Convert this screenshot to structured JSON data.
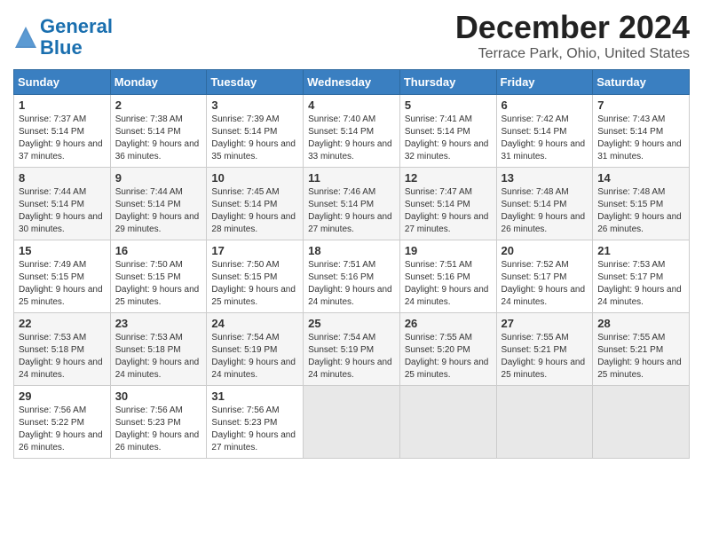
{
  "header": {
    "logo_line1": "General",
    "logo_line2": "Blue",
    "month": "December 2024",
    "location": "Terrace Park, Ohio, United States"
  },
  "weekdays": [
    "Sunday",
    "Monday",
    "Tuesday",
    "Wednesday",
    "Thursday",
    "Friday",
    "Saturday"
  ],
  "weeks": [
    [
      {
        "day": "1",
        "sunrise": "7:37 AM",
        "sunset": "5:14 PM",
        "daylight": "9 hours and 37 minutes."
      },
      {
        "day": "2",
        "sunrise": "7:38 AM",
        "sunset": "5:14 PM",
        "daylight": "9 hours and 36 minutes."
      },
      {
        "day": "3",
        "sunrise": "7:39 AM",
        "sunset": "5:14 PM",
        "daylight": "9 hours and 35 minutes."
      },
      {
        "day": "4",
        "sunrise": "7:40 AM",
        "sunset": "5:14 PM",
        "daylight": "9 hours and 33 minutes."
      },
      {
        "day": "5",
        "sunrise": "7:41 AM",
        "sunset": "5:14 PM",
        "daylight": "9 hours and 32 minutes."
      },
      {
        "day": "6",
        "sunrise": "7:42 AM",
        "sunset": "5:14 PM",
        "daylight": "9 hours and 31 minutes."
      },
      {
        "day": "7",
        "sunrise": "7:43 AM",
        "sunset": "5:14 PM",
        "daylight": "9 hours and 31 minutes."
      }
    ],
    [
      {
        "day": "8",
        "sunrise": "7:44 AM",
        "sunset": "5:14 PM",
        "daylight": "9 hours and 30 minutes."
      },
      {
        "day": "9",
        "sunrise": "7:44 AM",
        "sunset": "5:14 PM",
        "daylight": "9 hours and 29 minutes."
      },
      {
        "day": "10",
        "sunrise": "7:45 AM",
        "sunset": "5:14 PM",
        "daylight": "9 hours and 28 minutes."
      },
      {
        "day": "11",
        "sunrise": "7:46 AM",
        "sunset": "5:14 PM",
        "daylight": "9 hours and 27 minutes."
      },
      {
        "day": "12",
        "sunrise": "7:47 AM",
        "sunset": "5:14 PM",
        "daylight": "9 hours and 27 minutes."
      },
      {
        "day": "13",
        "sunrise": "7:48 AM",
        "sunset": "5:14 PM",
        "daylight": "9 hours and 26 minutes."
      },
      {
        "day": "14",
        "sunrise": "7:48 AM",
        "sunset": "5:15 PM",
        "daylight": "9 hours and 26 minutes."
      }
    ],
    [
      {
        "day": "15",
        "sunrise": "7:49 AM",
        "sunset": "5:15 PM",
        "daylight": "9 hours and 25 minutes."
      },
      {
        "day": "16",
        "sunrise": "7:50 AM",
        "sunset": "5:15 PM",
        "daylight": "9 hours and 25 minutes."
      },
      {
        "day": "17",
        "sunrise": "7:50 AM",
        "sunset": "5:15 PM",
        "daylight": "9 hours and 25 minutes."
      },
      {
        "day": "18",
        "sunrise": "7:51 AM",
        "sunset": "5:16 PM",
        "daylight": "9 hours and 24 minutes."
      },
      {
        "day": "19",
        "sunrise": "7:51 AM",
        "sunset": "5:16 PM",
        "daylight": "9 hours and 24 minutes."
      },
      {
        "day": "20",
        "sunrise": "7:52 AM",
        "sunset": "5:17 PM",
        "daylight": "9 hours and 24 minutes."
      },
      {
        "day": "21",
        "sunrise": "7:53 AM",
        "sunset": "5:17 PM",
        "daylight": "9 hours and 24 minutes."
      }
    ],
    [
      {
        "day": "22",
        "sunrise": "7:53 AM",
        "sunset": "5:18 PM",
        "daylight": "9 hours and 24 minutes."
      },
      {
        "day": "23",
        "sunrise": "7:53 AM",
        "sunset": "5:18 PM",
        "daylight": "9 hours and 24 minutes."
      },
      {
        "day": "24",
        "sunrise": "7:54 AM",
        "sunset": "5:19 PM",
        "daylight": "9 hours and 24 minutes."
      },
      {
        "day": "25",
        "sunrise": "7:54 AM",
        "sunset": "5:19 PM",
        "daylight": "9 hours and 24 minutes."
      },
      {
        "day": "26",
        "sunrise": "7:55 AM",
        "sunset": "5:20 PM",
        "daylight": "9 hours and 25 minutes."
      },
      {
        "day": "27",
        "sunrise": "7:55 AM",
        "sunset": "5:21 PM",
        "daylight": "9 hours and 25 minutes."
      },
      {
        "day": "28",
        "sunrise": "7:55 AM",
        "sunset": "5:21 PM",
        "daylight": "9 hours and 25 minutes."
      }
    ],
    [
      {
        "day": "29",
        "sunrise": "7:56 AM",
        "sunset": "5:22 PM",
        "daylight": "9 hours and 26 minutes."
      },
      {
        "day": "30",
        "sunrise": "7:56 AM",
        "sunset": "5:23 PM",
        "daylight": "9 hours and 26 minutes."
      },
      {
        "day": "31",
        "sunrise": "7:56 AM",
        "sunset": "5:23 PM",
        "daylight": "9 hours and 27 minutes."
      },
      null,
      null,
      null,
      null
    ]
  ]
}
